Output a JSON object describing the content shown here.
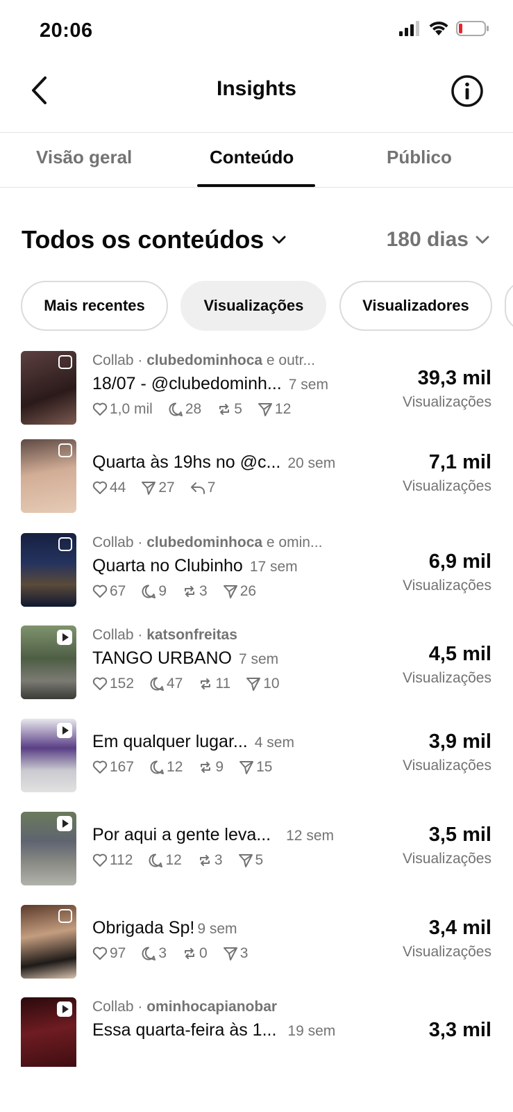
{
  "status_bar": {
    "time": "20:06"
  },
  "nav": {
    "title": "Insights"
  },
  "tabs": [
    {
      "label": "Visão geral"
    },
    {
      "label": "Conteúdo",
      "active": true
    },
    {
      "label": "Público"
    }
  ],
  "section": {
    "title": "Todos os conteúdos",
    "range": "180 dias"
  },
  "filters": [
    {
      "label": "Mais recentes"
    },
    {
      "label": "Visualizações",
      "selected": true
    },
    {
      "label": "Visualizadores"
    }
  ],
  "posts": [
    {
      "collab_prefix": "Collab · ",
      "collab_account": "clubedominhoca",
      "collab_suffix": " e outr...",
      "caption": "18/07 - @clubedominh...",
      "age": "7 sem",
      "likes": "1,0 mil",
      "comments": "28",
      "reposts": "5",
      "shares": "12",
      "metric": "39,3 mil",
      "metric_label": "Visualizações",
      "thumb_color": "#3b2a2a",
      "thumb_icon": "carousel-icon"
    },
    {
      "caption": "Quarta às 19hs no @c...",
      "age": "20 sem",
      "likes": "44",
      "shares": "27",
      "replies": "7",
      "metric": "7,1 mil",
      "metric_label": "Visualizações",
      "thumb_color": "#c9a48f",
      "thumb_icon": "carousel-icon"
    },
    {
      "collab_prefix": "Collab · ",
      "collab_account": "clubedominhoca",
      "collab_suffix": " e omin...",
      "caption": "Quarta no Clubinho",
      "age": "17 sem",
      "likes": "67",
      "comments": "9",
      "reposts": "3",
      "shares": "26",
      "metric": "6,9 mil",
      "metric_label": "Visualizações",
      "thumb_color": "#1d2748",
      "thumb_icon": "carousel-icon"
    },
    {
      "collab_prefix": "Collab · ",
      "collab_account": "katsonfreitas",
      "collab_suffix": "",
      "caption": "TANGO URBANO",
      "age": "7 sem",
      "likes": "152",
      "comments": "47",
      "reposts": "11",
      "shares": "10",
      "metric": "4,5 mil",
      "metric_label": "Visualizações",
      "thumb_color": "#5a6b4e",
      "thumb_icon": "reel-icon"
    },
    {
      "caption": "Em qualquer lugar...",
      "age": "4 sem",
      "likes": "167",
      "comments": "12",
      "reposts": "9",
      "shares": "15",
      "metric": "3,9 mil",
      "metric_label": "Visualizações",
      "thumb_color": "#8e86a8",
      "thumb_icon": "reel-icon"
    },
    {
      "caption": "Por aqui a gente leva...",
      "age": "12 sem",
      "likes": "112",
      "comments": "12",
      "reposts": "3",
      "shares": "5",
      "metric": "3,5 mil",
      "metric_label": "Visualizações",
      "thumb_color": "#6f7468",
      "thumb_icon": "reel-icon"
    },
    {
      "caption": "Obrigada Sp!",
      "age": "9 sem",
      "likes": "97",
      "comments": "3",
      "reposts": "0",
      "shares": "3",
      "metric": "3,4 mil",
      "metric_label": "Visualizações",
      "thumb_color": "#a3846c",
      "thumb_icon": "carousel-icon"
    },
    {
      "collab_prefix": "Collab · ",
      "collab_account": "ominhocapianobar",
      "collab_suffix": "",
      "caption": "Essa quarta-feira às 1...",
      "age": "19 sem",
      "metric": "3,3 mil",
      "thumb_color": "#4a1418",
      "thumb_icon": "reel-icon"
    }
  ]
}
